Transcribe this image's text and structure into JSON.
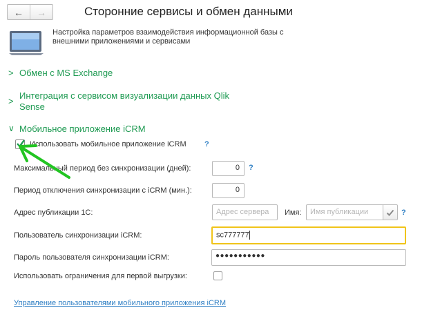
{
  "window": {
    "nav_back": "←",
    "nav_forward": "→",
    "title": "Сторонние сервисы и обмен данными",
    "description_line1": "Настройка параметров взаимодействия информационной базы с",
    "description_line2": "внешними приложениями и сервисами",
    "header_icon": "monitor-icon"
  },
  "sections": {
    "exchange": {
      "chevron": ">",
      "label": "Обмен с  MS Exchange"
    },
    "qlik": {
      "chevron": ">",
      "label_line1": "Интеграция с сервисом визуализации данных Qlik",
      "label_line2": "Sense"
    },
    "icrm": {
      "chevron": "∨",
      "label": "Мобильное приложение  iCRM"
    }
  },
  "icrm_form": {
    "use_app": {
      "label": "Использовать мобильное приложение iCRM",
      "checked": true,
      "help": "?"
    },
    "max_period": {
      "label": "Максимальный период без синхронизации (дней):",
      "value": "0",
      "help": "?"
    },
    "disable_period": {
      "label": "Период отключения синхронизации с iCRM (мин.):",
      "value": "0"
    },
    "publication": {
      "label": "Адрес публикации 1С:",
      "server_placeholder": "Адрес сервера",
      "name_label": "Имя:",
      "name_placeholder": "Имя публикации",
      "help": "?"
    },
    "sync_user": {
      "label": "Пользователь синхронизации iCRM:",
      "value": "sc777777"
    },
    "sync_password": {
      "label": "Пароль пользователя синхронизации iCRM:",
      "value": "●●●●●●●●●●●"
    },
    "first_upload_limits": {
      "label": "Использовать ограничения для первой выгрузки:",
      "checked": false
    }
  },
  "footer": {
    "manage_users_link": "Управление пользователями мобильного приложения iCRM"
  },
  "colors": {
    "accent_green": "#1e9a52",
    "link_blue": "#2f7fc4",
    "focus_yellow": "#f0c419",
    "arrow_green": "#22c522"
  }
}
